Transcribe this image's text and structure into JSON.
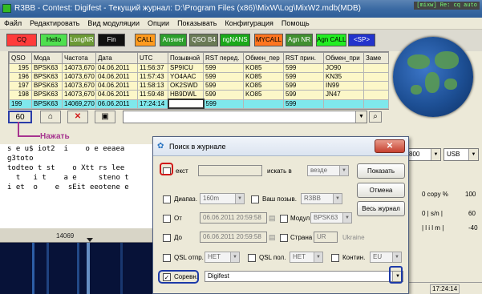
{
  "window": {
    "title": "R3BB - Contest: Digifest - Текущий журнал: D:\\Program Files (x86)\\MixW\\Log\\MixW2.mdb(MDB)",
    "corner_caption": "[mixw] Re: cq auto"
  },
  "menu": [
    "Файл",
    "Редактировать",
    "Вид модуляции",
    "Опции",
    "Показывать",
    "Конфигурация",
    "Помощь"
  ],
  "macros": [
    {
      "label": "CQ",
      "bg": "#ff3b3b",
      "fg": "#000000"
    },
    {
      "label": "Hello",
      "bg": "#4fe04f",
      "fg": "#000000"
    },
    {
      "label": "LongNR",
      "bg": "#6c9a35",
      "fg": "#ffffff"
    },
    {
      "label": "Fin",
      "bg": "#111111",
      "fg": "#ffffff"
    },
    {
      "label": "CALL",
      "bg": "#ff9a1e",
      "fg": "#000000"
    },
    {
      "label": "Answer",
      "bg": "#2c9e2c",
      "fg": "#ffffff"
    },
    {
      "label": "QSO B4",
      "bg": "#6a7a55",
      "fg": "#ffffff"
    },
    {
      "label": "ngNANS",
      "bg": "#1aa81a",
      "fg": "#ffffff"
    },
    {
      "label": "MYCALL",
      "bg": "#ff7520",
      "fg": "#000000"
    },
    {
      "label": "Agn NR",
      "bg": "#3f8f2f",
      "fg": "#ffffff"
    },
    {
      "label": "Agn CALL",
      "bg": "#22ee22",
      "fg": "#000000"
    },
    {
      "label": "<SP>",
      "bg": "#2233cc",
      "fg": "#ffffff"
    }
  ],
  "log": {
    "columns": [
      "QSO",
      "Мода",
      "Частота",
      "Дата",
      "UTC",
      "Позывной",
      "RST перед.",
      "Обмен_пер",
      "RST прин.",
      "Обмен_при",
      "Заме"
    ],
    "rows": [
      [
        "195",
        "BPSK63",
        "14073,670",
        "04.06.2011",
        "11:56:37",
        "SP9ICU",
        "599",
        "KO85",
        "599",
        "JO90",
        ""
      ],
      [
        "196",
        "BPSK63",
        "14073,670",
        "04.06.2011",
        "11:57:43",
        "YO4AAC",
        "599",
        "KO85",
        "599",
        "KN35",
        ""
      ],
      [
        "197",
        "BPSK63",
        "14073,670",
        "04.06.2011",
        "11:58:13",
        "OK2SWD",
        "599",
        "KO85",
        "599",
        "IN99",
        ""
      ],
      [
        "198",
        "BPSK63",
        "14073,670",
        "04.06.2011",
        "11:59:48",
        "HB9DWL",
        "599",
        "KO85",
        "599",
        "JN47",
        ""
      ]
    ],
    "current": [
      "199",
      "BPSK63",
      "14069,270",
      "06.06.2011",
      "17:24:14",
      "",
      "599",
      "",
      "599",
      "",
      ""
    ]
  },
  "toolbar": {
    "binoculars": "60",
    "search_glyph": "⌕"
  },
  "annotation": "Нажать",
  "rx_text": "s e u$ iot2  i    o e eeaea\ng3toto\ntodteo t st    o Xtt rs lee\n  t   i t    a e     steno t\ni et  o    e  sEit eeotene e",
  "waterfall": {
    "freq": "14069"
  },
  "right_panel": {
    "val800": "800",
    "usb": "USB",
    "copy_label": "0  copy %",
    "copy_max": "100",
    "sn_label": "0  | s/n |",
    "sn_max": "60",
    "lil_label": "| l i l m |",
    "lil_max": "-40",
    "utc": "17:24:14"
  },
  "dialog": {
    "title": "Поиск в журнале",
    "text_label": "екст",
    "search_in_label": "искать в",
    "search_in_value": "везде",
    "btn_show": "Показать",
    "btn_cancel": "Отмена",
    "btn_all": "Весь журнал",
    "diap_label": "Диапаз.",
    "diap_value": "160m",
    "mycall_label": "Ваш позыв.",
    "mycall_value": "R3BB",
    "from_label": "От",
    "from_value": "06.06.2011 20:59:58",
    "mode_label": "Модул",
    "mode_value": "BPSK63",
    "to_label": "До",
    "to_value": "06.06.2011 20:59:58",
    "country_label": "Страна",
    "country_code": "UR",
    "country_name": "Ukraine",
    "qsl_sent_label": "QSL отпр.",
    "qsl_sent_value": "НЕТ",
    "qsl_rcvd_label": "QSL пол.",
    "qsl_rcvd_value": "НЕТ",
    "continent_label": "Контин.",
    "continent_value": "EU",
    "contest_label": "Соревн.",
    "contest_value": "Digifest"
  }
}
